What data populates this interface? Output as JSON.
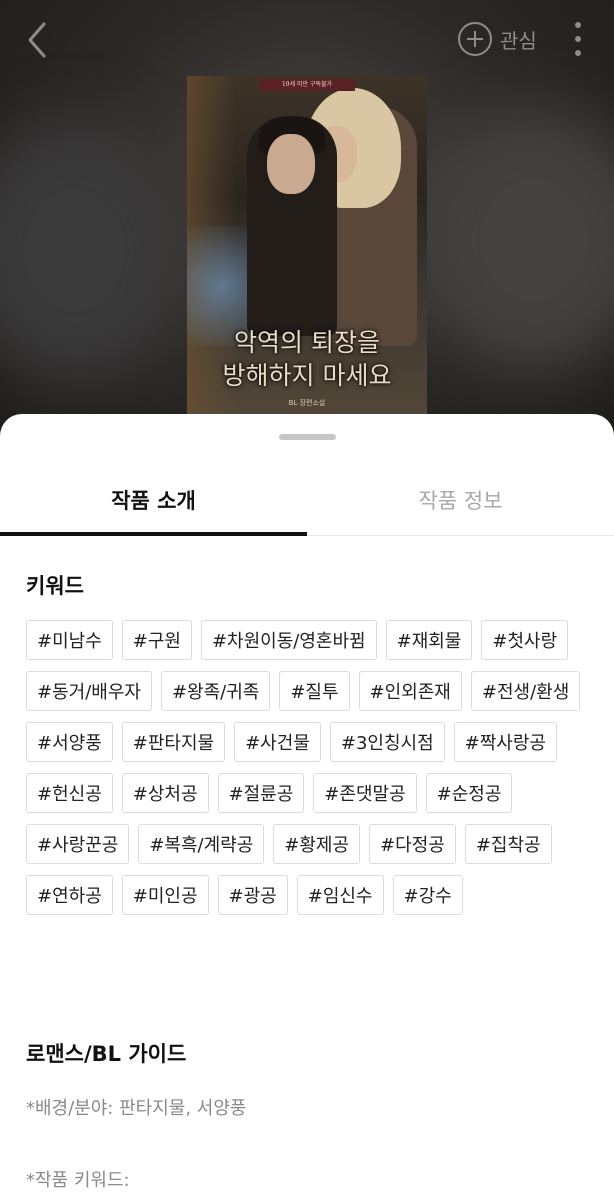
{
  "header": {
    "interest_label": "관심",
    "icons": {
      "back": "chevron-left-icon",
      "interest": "plus-circle-icon",
      "more": "more-vertical-icon"
    }
  },
  "cover": {
    "top_label": "19세 미만 구독불가",
    "title_line1": "악역의 퇴장을",
    "title_line2": "방해하지 마세요",
    "author_label": "BL 장편소설"
  },
  "tabs": [
    {
      "label": "작품 소개",
      "active": true
    },
    {
      "label": "작품 정보",
      "active": false
    }
  ],
  "keywords": {
    "title": "키워드",
    "tags": [
      "#미남수",
      "#구원",
      "#차원이동/영혼바뀜",
      "#재회물",
      "#첫사랑",
      "#동거/배우자",
      "#왕족/귀족",
      "#질투",
      "#인외존재",
      "#전생/환생",
      "#서양풍",
      "#판타지물",
      "#사건물",
      "#3인칭시점",
      "#짝사랑공",
      "#헌신공",
      "#상처공",
      "#절륜공",
      "#존댓말공",
      "#순정공",
      "#사랑꾼공",
      "#복흑/계략공",
      "#황제공",
      "#다정공",
      "#집착공",
      "#연하공",
      "#미인공",
      "#광공",
      "#임신수",
      "#강수"
    ]
  },
  "guide": {
    "title": "로맨스/BL 가이드",
    "background_line": "*배경/분야: 판타지물, 서양풍",
    "keyword_line": "*작품 키워드:"
  },
  "colors": {
    "tab_active": "#111111",
    "tab_inactive": "#a8a8a8",
    "tag_border": "#dcdcdc",
    "guide_text": "#8a8a8a"
  }
}
